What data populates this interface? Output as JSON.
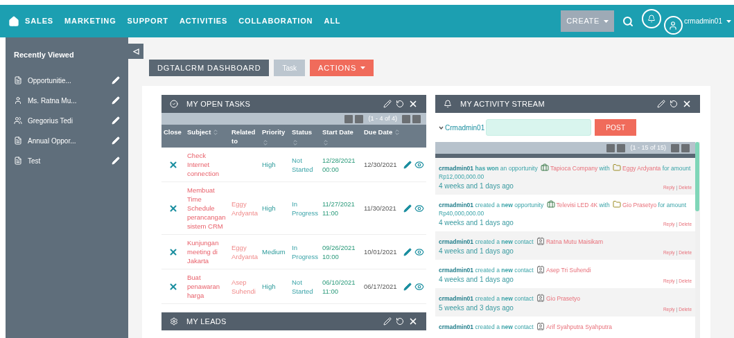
{
  "nav": {
    "items": [
      "SALES",
      "MARKETING",
      "SUPPORT",
      "ACTIVITIES",
      "COLLABORATION",
      "ALL"
    ],
    "create": "CREATE",
    "user": "crmadmin01"
  },
  "sidebar": {
    "title": "Recently Viewed",
    "items": [
      {
        "label": "Opportunitie...",
        "kind": "document"
      },
      {
        "label": "Ms. Ratna Mu...",
        "kind": "person"
      },
      {
        "label": "Gregorius Tedi",
        "kind": "group"
      },
      {
        "label": "Annual Oppor...",
        "kind": "document"
      },
      {
        "label": "Test",
        "kind": "document"
      }
    ]
  },
  "dashboard_tabs": [
    {
      "label": "DGTALCRM DASHBOARD",
      "selected": true
    },
    {
      "label": "Task",
      "selected": false
    }
  ],
  "actions": "ACTIONS",
  "open_tasks": {
    "title": "MY OPEN TASKS",
    "pagination": "(1 - 4 of 4)",
    "columns": [
      {
        "label": "Close",
        "sortable": false
      },
      {
        "label": "Subject",
        "sortable": true
      },
      {
        "label": "Related to",
        "sortable": false
      },
      {
        "label": "Priority",
        "sortable": true
      },
      {
        "label": "Status",
        "sortable": true
      },
      {
        "label": "Start Date",
        "sortable": true
      },
      {
        "label": "Due Date",
        "sortable": true
      }
    ],
    "rows": [
      {
        "subject": "Check Internet connection",
        "related": "",
        "priority": "High",
        "status": "Not Started",
        "start": "12/28/2021 00:00",
        "due": "12/30/2021"
      },
      {
        "subject": "Membuat Time Schedule perancangan sistem CRM",
        "related": "Eggy Ardyanta",
        "priority": "High",
        "status": "In Progress",
        "start": "11/27/2021 11:00",
        "due": "11/30/2021"
      },
      {
        "subject": "Kunjungan meeting di Jakarta",
        "related": "Eggy Ardyanta",
        "priority": "Medium",
        "status": "In Progress",
        "start": "09/26/2021 10:00",
        "due": "10/01/2021"
      },
      {
        "subject": "Buat penawaran harga",
        "related": "Asep Suhendi",
        "priority": "High",
        "status": "Not Started",
        "start": "06/10/2021 11:00",
        "due": "06/17/2021"
      }
    ]
  },
  "activity_stream": {
    "title": "MY ACTIVITY STREAM",
    "user": "Crmadmin01",
    "post": "POST",
    "pagination": "(1 - 15 of 15)",
    "items": [
      {
        "user": "crmadmin01",
        "action": "**has won** an opportunity",
        "target": {
          "kind": "opportunity",
          "text": "Tapioca Company"
        },
        "joiner": "with",
        "target2": {
          "kind": "account",
          "text": "Eggy Ardyanta"
        },
        "tail": "for amount Rp12,000,000.00",
        "time": "4 weeks and 1 days ago",
        "reply": "Reply",
        "separator": "|",
        "delete": "Delete"
      },
      {
        "user": "crmadmin01",
        "action": "created a **new** opportunity",
        "target": {
          "kind": "opportunity",
          "text": "Televisi LED 4K"
        },
        "joiner": "with",
        "target2": {
          "kind": "account",
          "text": "Gio Prasetyo"
        },
        "tail": "for amount Rp40,000,000.00",
        "time": "4 weeks and 1 days ago",
        "reply": "Reply",
        "separator": "|",
        "delete": "Delete"
      },
      {
        "user": "crmadmin01",
        "action": "created a **new** contact",
        "target": {
          "kind": "contact",
          "text": "Ratna Mutu Maisikam"
        },
        "time": "4 weeks and 1 days ago",
        "reply": "Reply",
        "separator": "|",
        "delete": "Delete"
      },
      {
        "user": "crmadmin01",
        "action": "created a **new** contact",
        "target": {
          "kind": "contact",
          "text": "Asep Tri Suhendi"
        },
        "time": "4 weeks and 1 days ago",
        "reply": "Reply",
        "separator": "|",
        "delete": "Delete"
      },
      {
        "user": "crmadmin01",
        "action": "created a **new** contact",
        "target": {
          "kind": "contact",
          "text": "Gio Prasetyo"
        },
        "time": "5 weeks and 3 days ago",
        "reply": "Reply",
        "separator": "|",
        "delete": "Delete"
      },
      {
        "user": "crmadmin01",
        "action": "created a **new** contact",
        "target": {
          "kind": "contact",
          "text": "Arif Syahputra Syahputra"
        }
      }
    ]
  },
  "leads": {
    "title": "MY LEADS"
  }
}
